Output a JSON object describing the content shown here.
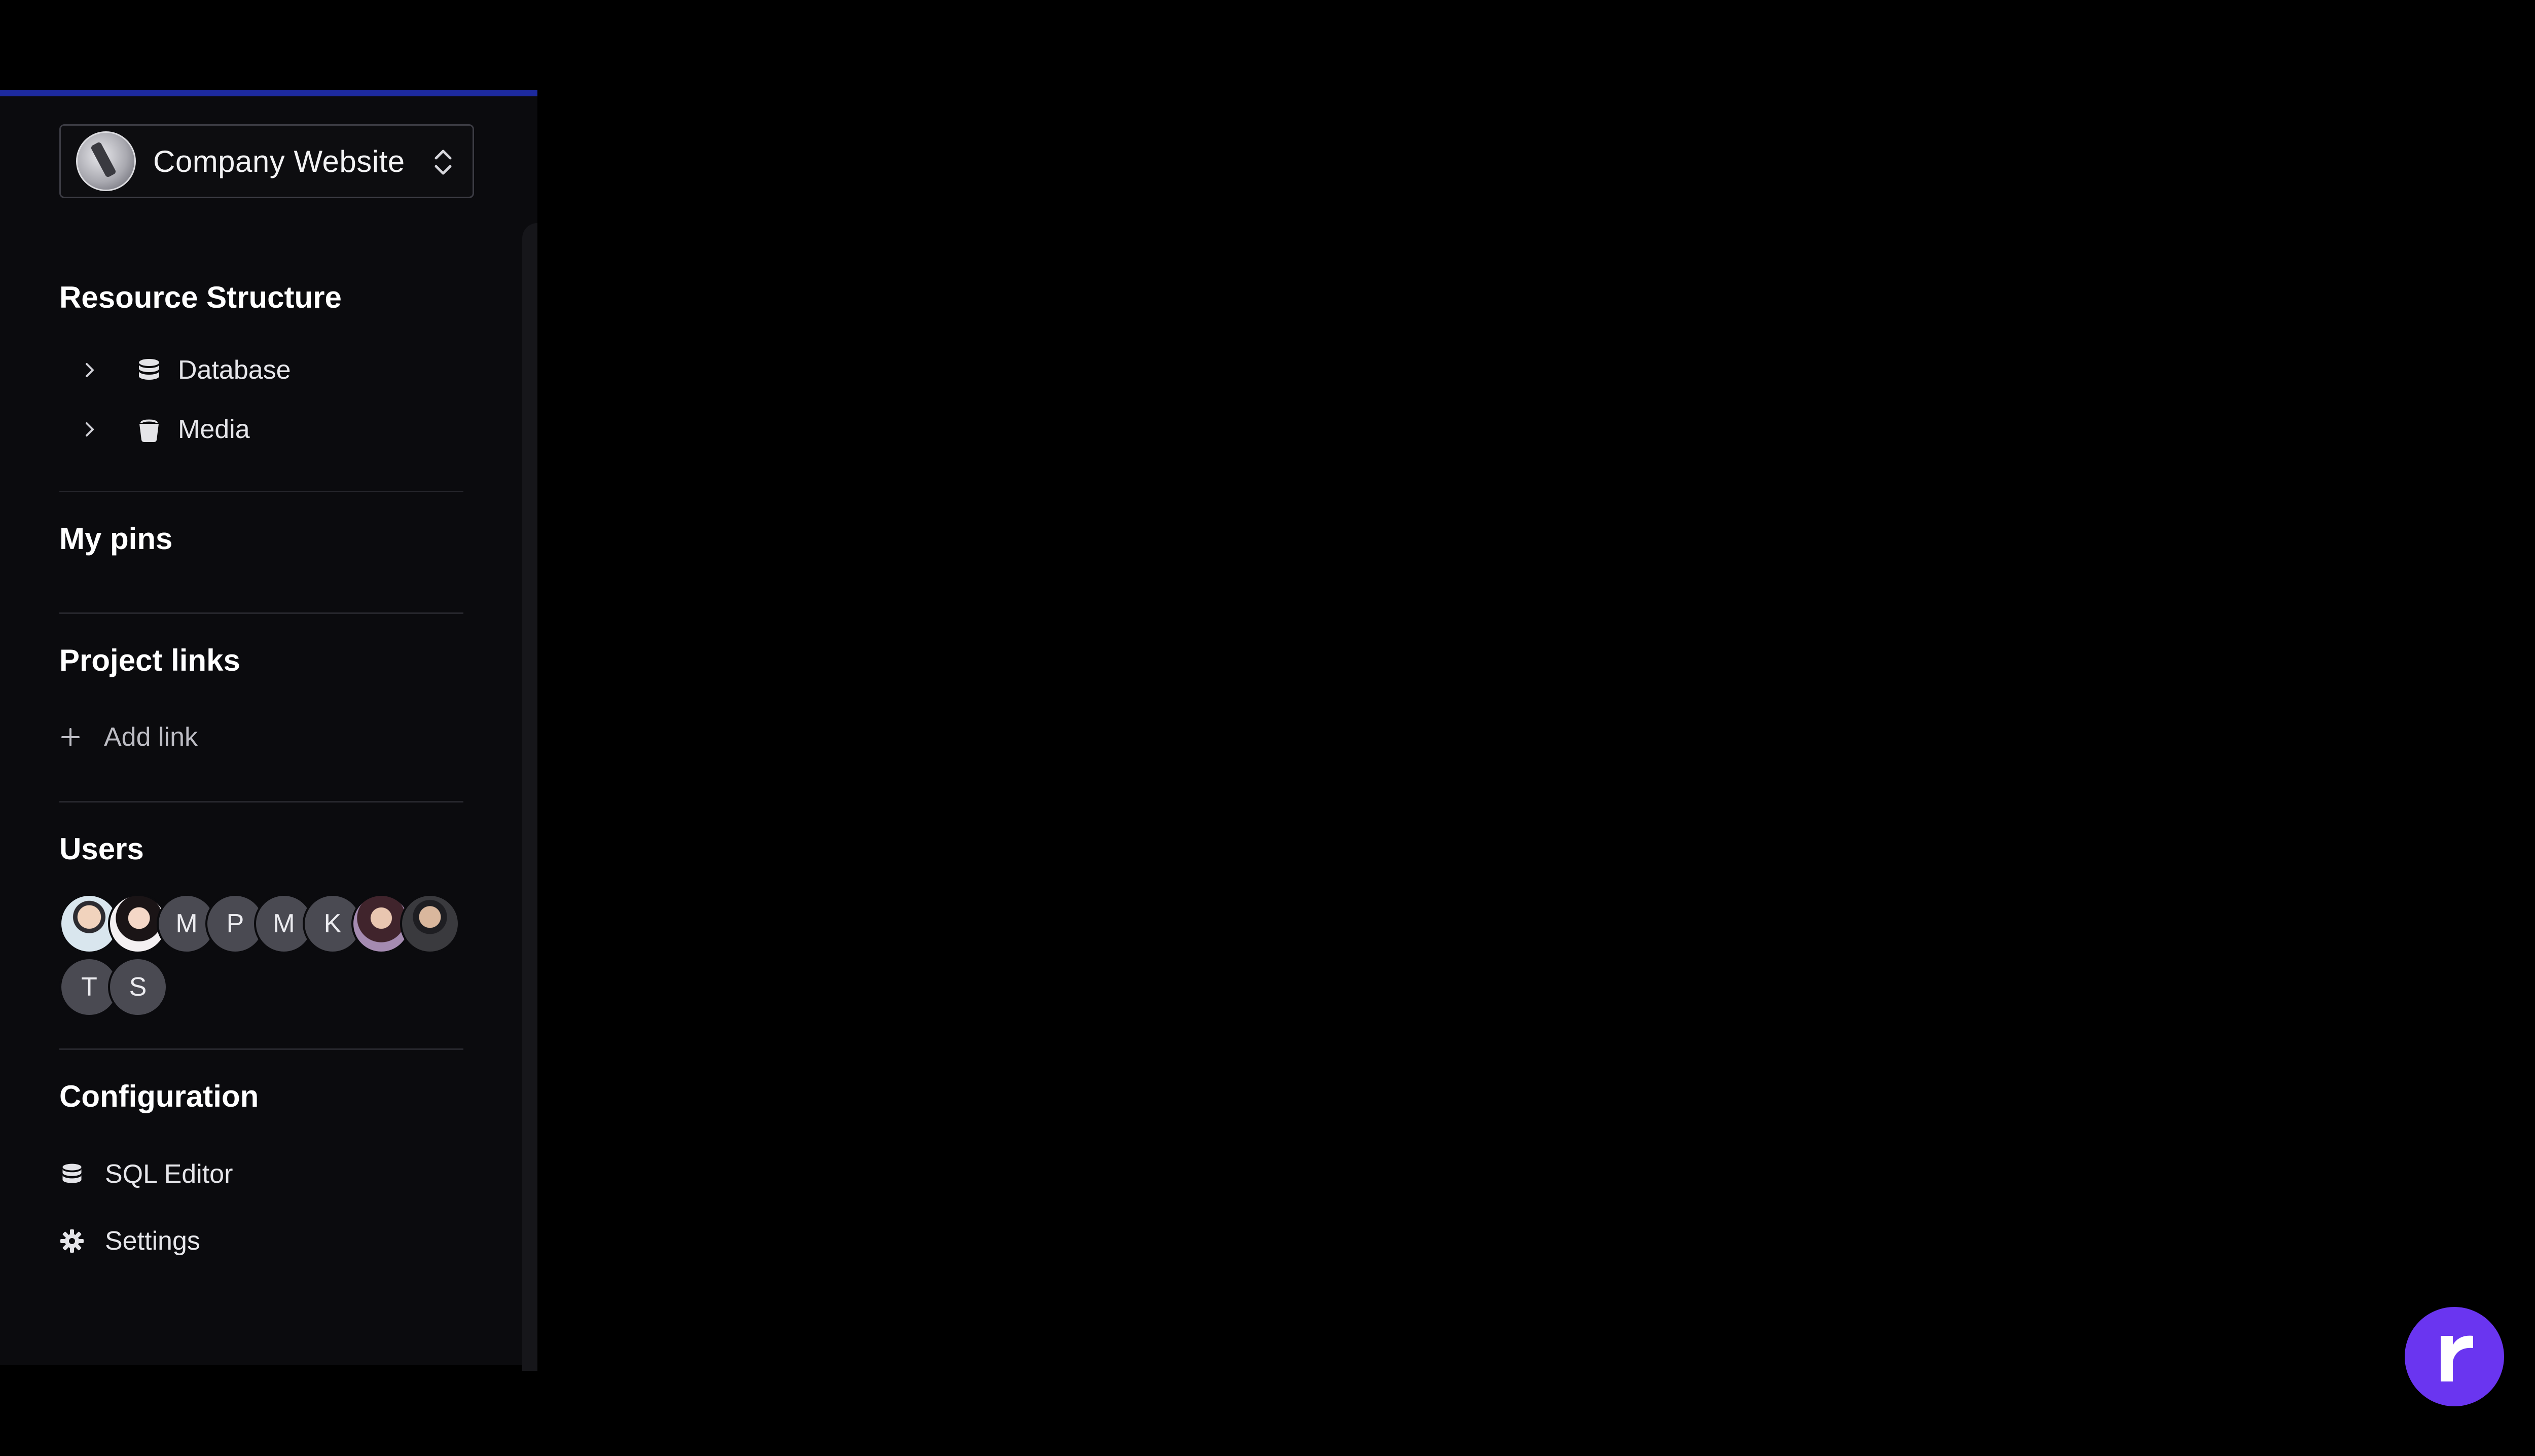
{
  "project": {
    "name": "Company Website"
  },
  "resource_structure": {
    "title": "Resource Structure",
    "items": [
      {
        "label": "Database",
        "icon": "database-icon"
      },
      {
        "label": "Media",
        "icon": "bucket-icon"
      }
    ]
  },
  "pins": {
    "title": "My pins"
  },
  "project_links": {
    "title": "Project links",
    "add_label": "Add link"
  },
  "users": {
    "title": "Users",
    "avatars": [
      {
        "initial": "",
        "type": "photo"
      },
      {
        "initial": "",
        "type": "photo"
      },
      {
        "initial": "M",
        "type": "initial"
      },
      {
        "initial": "P",
        "type": "initial"
      },
      {
        "initial": "M",
        "type": "initial"
      },
      {
        "initial": "K",
        "type": "initial"
      },
      {
        "initial": "",
        "type": "photo"
      },
      {
        "initial": "",
        "type": "photo"
      },
      {
        "initial": "T",
        "type": "initial"
      },
      {
        "initial": "S",
        "type": "initial"
      }
    ]
  },
  "configuration": {
    "title": "Configuration",
    "items": [
      {
        "label": "SQL Editor",
        "icon": "database-icon"
      },
      {
        "label": "Settings",
        "icon": "gear-icon"
      }
    ]
  },
  "colors": {
    "background": "#000000",
    "sidebar": "#0b0b0e",
    "accent_bar": "#1d2a9e",
    "fab": "#6a35f0"
  }
}
